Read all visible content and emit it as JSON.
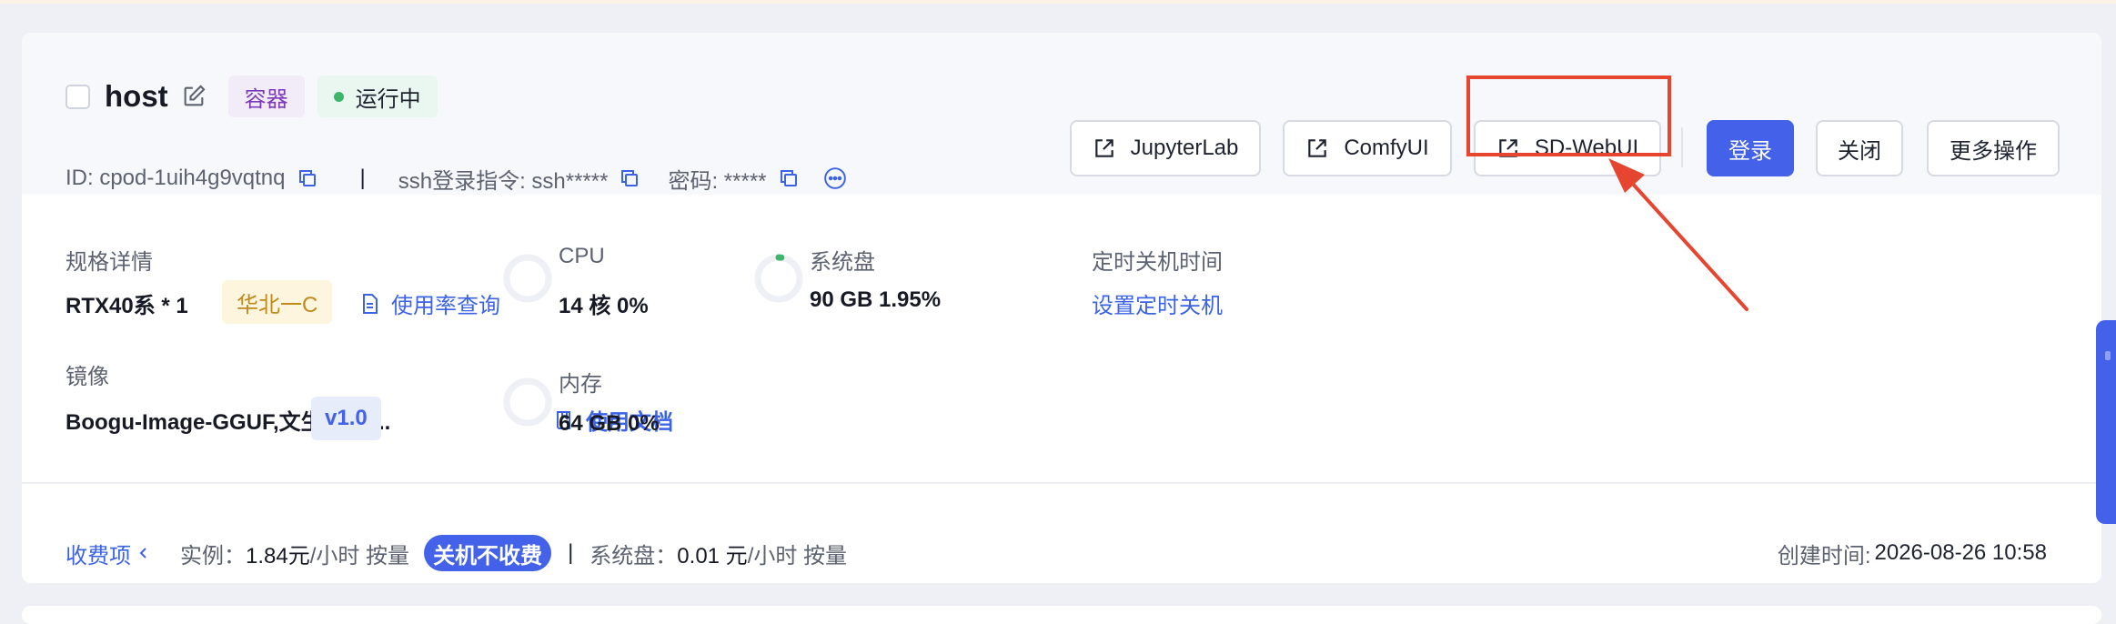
{
  "instance": {
    "name": "host",
    "type_tag": "容器",
    "status": "运行中",
    "id_text": "ID: cpod-1uih4g9vqtnq",
    "separator": "|",
    "ssh_text": "ssh登录指令: ssh*****",
    "password_text": "密码: *****"
  },
  "actions": {
    "jupyterlab": "JupyterLab",
    "comfyui": "ComfyUI",
    "sdwebui": "SD-WebUI",
    "login": "登录",
    "shutdown": "关闭",
    "more": "更多操作"
  },
  "spec": {
    "label": "规格详情",
    "value": "RTX40系 * 1",
    "region": "华北一C",
    "usage_link": "使用率查询"
  },
  "image": {
    "label": "镜像",
    "value": "Boogu-Image-GGUF,文生图,图...",
    "version": "v1.0",
    "docs_link": "使用文档"
  },
  "cpu": {
    "label": "CPU",
    "value": "14 核 0%",
    "usage_fraction": 0.0
  },
  "memory": {
    "label": "内存",
    "value": "64 GB 0%",
    "usage_fraction": 0.0
  },
  "disk": {
    "label": "系统盘",
    "value": "90 GB 1.95%",
    "usage_fraction": 0.0195
  },
  "schedule": {
    "label": "定时关机时间",
    "link": "设置定时关机"
  },
  "billing": {
    "toggle": "收费项",
    "instance_label": "实例：",
    "instance_price": "1.84元",
    "instance_unit": "/小时 按量",
    "pill": "关机不收费",
    "bar": "|",
    "disk_label": "系统盘：",
    "disk_price": "0.01 元",
    "disk_unit": "/小时 按量"
  },
  "created": {
    "label": "创建时间:",
    "value": "2026-08-26 10:58"
  },
  "colors": {
    "primary": "#4461ea",
    "highlight": "#e6452f",
    "running": "#3cb66b",
    "container_tag": "#7b3bb8",
    "region_tag": "#c08a1d"
  }
}
